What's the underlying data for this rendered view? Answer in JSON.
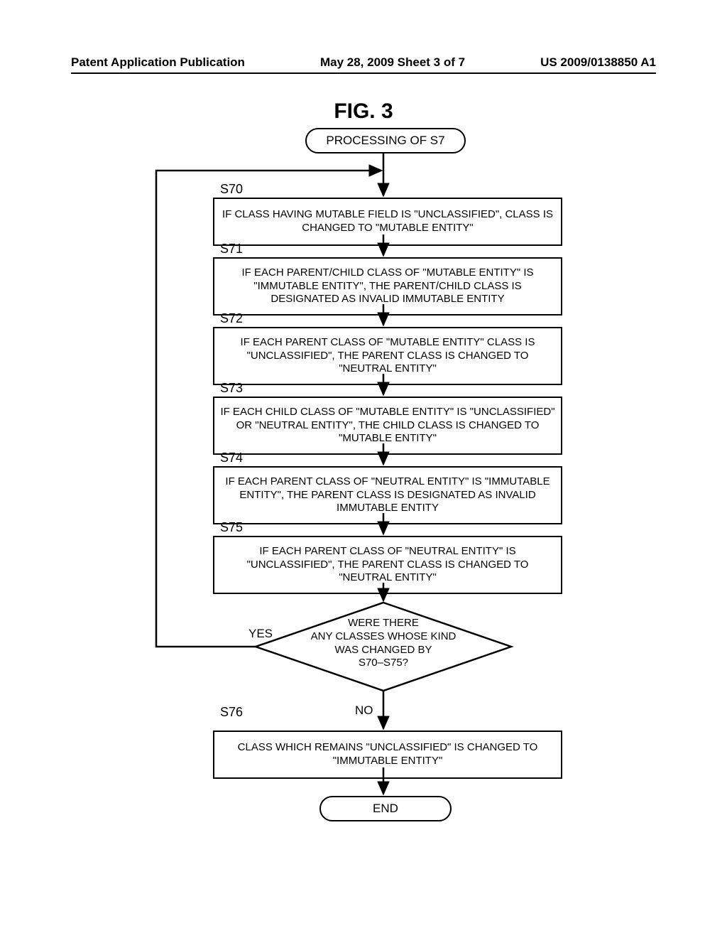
{
  "header": {
    "left": "Patent Application Publication",
    "center": "May 28, 2009  Sheet 3 of 7",
    "right": "US 2009/0138850 A1"
  },
  "figure_title": "FIG. 3",
  "terminals": {
    "start": "PROCESSING OF S7",
    "end": "END"
  },
  "steps": [
    {
      "id": "S70",
      "text": "IF CLASS HAVING MUTABLE FIELD IS \"UNCLASSIFIED\", CLASS IS CHANGED TO \"MUTABLE ENTITY\""
    },
    {
      "id": "S71",
      "text": "IF EACH PARENT/CHILD CLASS OF \"MUTABLE ENTITY\" IS \"IMMUTABLE ENTITY\", THE PARENT/CHILD CLASS IS DESIGNATED AS INVALID IMMUTABLE ENTITY"
    },
    {
      "id": "S72",
      "text": "IF EACH PARENT CLASS OF \"MUTABLE ENTITY\" CLASS IS \"UNCLASSIFIED\", THE PARENT CLASS IS CHANGED TO \"NEUTRAL ENTITY\""
    },
    {
      "id": "S73",
      "text": "IF EACH CHILD CLASS OF \"MUTABLE ENTITY\" IS \"UNCLASSIFIED\" OR \"NEUTRAL ENTITY\", THE CHILD CLASS IS CHANGED TO \"MUTABLE ENTITY\""
    },
    {
      "id": "S74",
      "text": "IF EACH PARENT CLASS OF \"NEUTRAL ENTITY\" IS \"IMMUTABLE ENTITY\", THE PARENT CLASS IS DESIGNATED AS INVALID IMMUTABLE ENTITY"
    },
    {
      "id": "S75",
      "text": "IF EACH PARENT CLASS OF \"NEUTRAL ENTITY\" IS \"UNCLASSIFIED\", THE PARENT CLASS IS CHANGED TO \"NEUTRAL ENTITY\""
    },
    {
      "id": "S76",
      "text": "CLASS WHICH REMAINS \"UNCLASSIFIED\" IS CHANGED TO \"IMMUTABLE ENTITY\""
    }
  ],
  "decision": {
    "text_l1": "WERE THERE",
    "text_l2": "ANY CLASSES WHOSE KIND",
    "text_l3": "WAS CHANGED BY",
    "text_l4": "S70–S75?",
    "yes": "YES",
    "no": "NO"
  }
}
